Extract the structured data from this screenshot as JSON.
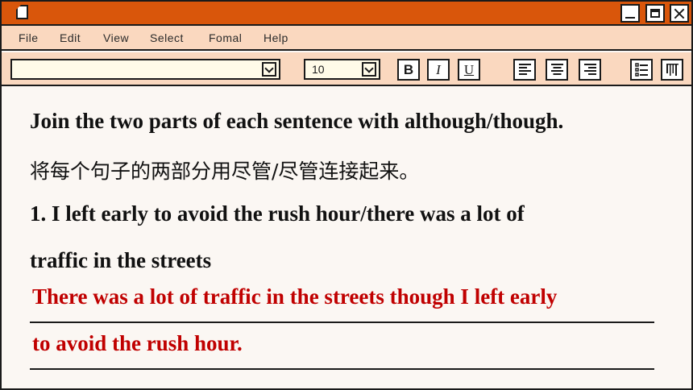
{
  "window": {
    "controls": {
      "minimize": "minimize",
      "maximize": "maximize",
      "close": "close"
    }
  },
  "menu": {
    "items": [
      "File",
      "Edit",
      "View",
      "Select",
      "Fomal",
      "Help"
    ]
  },
  "toolbar": {
    "font_value": "",
    "size_value": "10",
    "bold_label": "B",
    "italic_label": "I",
    "underline_label": "U"
  },
  "content": {
    "instruction_en": "Join the two parts of each sentence with although/though.",
    "instruction_cn": "将每个句子的两部分用尽管/尽管连接起来。",
    "question_line1": "1. I left early to avoid the rush hour/there was a lot of",
    "question_line2": "traffic in the streets",
    "answer_line1": "There was a lot of traffic in the streets though I left early",
    "answer_line2": "to avoid the rush hour."
  },
  "colors": {
    "titlebar": "#d9560b",
    "menubar": "#fad8bf",
    "answer_text": "#c00000",
    "page": "#fbf7f3"
  },
  "icons": {
    "window": "document-icon",
    "align": [
      "align-left-icon",
      "align-center-icon",
      "align-right-icon"
    ],
    "list": [
      "bullet-list-icon",
      "columns-icon"
    ]
  }
}
